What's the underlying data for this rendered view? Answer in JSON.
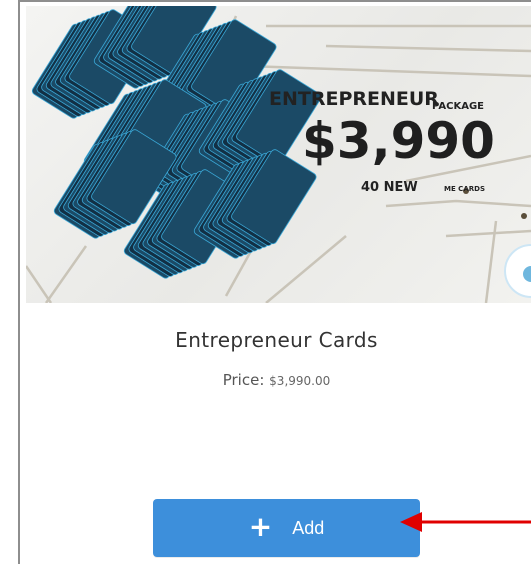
{
  "banner": {
    "line1": "ENTREPRENEUR",
    "line2": "PACKAGE",
    "price": "$3,990",
    "sub_count": "40 NEW",
    "sub_small": "ME CARDS"
  },
  "product": {
    "name": "Entrepreneur Cards",
    "price_label": "Price:",
    "price_value": "$3,990.00"
  },
  "add_button": {
    "label": "Add",
    "icon": "plus-icon"
  },
  "annotation": {
    "arrow_color": "#e00000",
    "arrow_icon": "red-arrow-annotation"
  },
  "colors": {
    "button": "#3d8fdb",
    "card_border": "#8e8e8e"
  }
}
